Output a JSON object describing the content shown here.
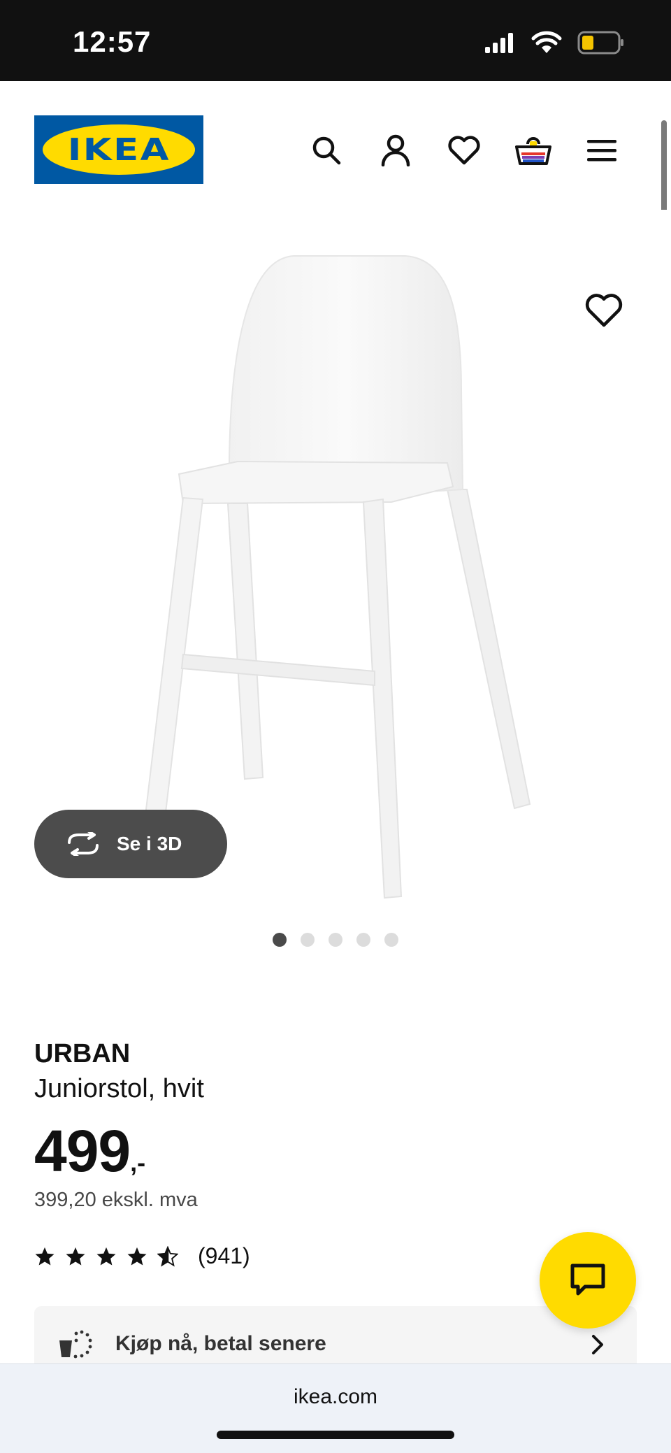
{
  "status_bar": {
    "time": "12:57",
    "icons": [
      "signal-icon",
      "wifi-icon",
      "battery-icon"
    ],
    "battery_color": "#f5c400"
  },
  "header": {
    "logo_text": "IKEA",
    "icons": [
      "search-icon",
      "account-icon",
      "favourites-icon",
      "basket-icon",
      "menu-icon"
    ],
    "brand_blue": "#0058a3",
    "brand_yellow": "#ffdb00"
  },
  "gallery": {
    "view_3d_label": "Se i 3D",
    "dot_count": 5,
    "active_dot": 0
  },
  "product": {
    "name": "URBAN",
    "description": "Juniorstol, hvit",
    "price_integer": "499",
    "price_suffix": ",-",
    "price_ex_vat": "399,20 ekskl. mva",
    "rating_stars": 4.5,
    "rating_count": "(941)"
  },
  "bnpl": {
    "label": "Kjøp nå, betal senere"
  },
  "browser": {
    "url": "ikea.com"
  }
}
